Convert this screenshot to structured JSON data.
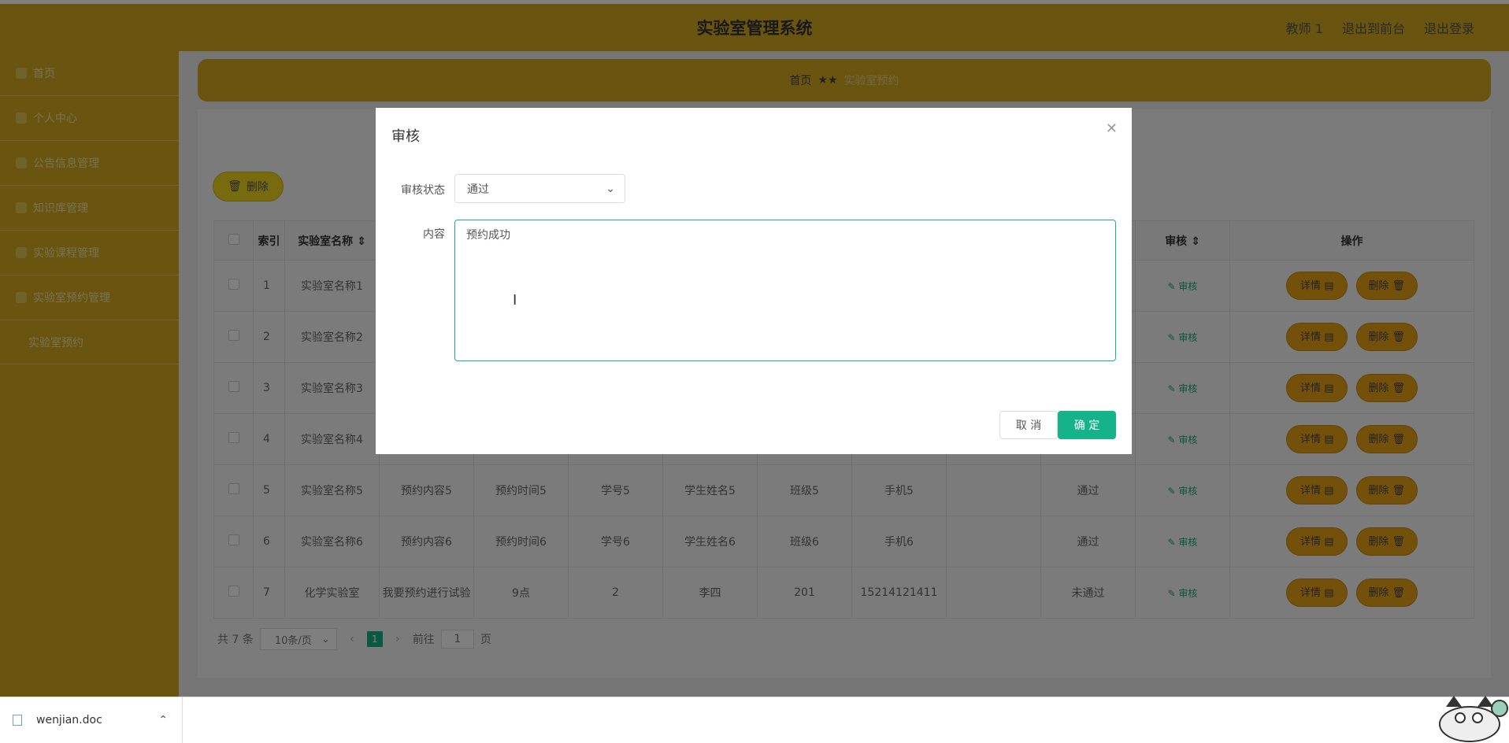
{
  "header": {
    "title": "实验室管理系统",
    "user": "教师 1",
    "back_to_front": "退出到前台",
    "logout": "退出登录"
  },
  "sidebar": {
    "items": [
      {
        "label": "首页"
      },
      {
        "label": "个人中心"
      },
      {
        "label": "公告信息管理"
      },
      {
        "label": "知识库管理"
      },
      {
        "label": "实验课程管理"
      },
      {
        "label": "实验室预约管理"
      }
    ],
    "sub_item": "实验室预约"
  },
  "breadcrumb": {
    "home": "首页",
    "sep": "★★",
    "current": "实验室预约"
  },
  "toolbar": {
    "delete_label": "删除"
  },
  "table": {
    "headers": [
      "索引",
      "实验室名称",
      "",
      "",
      "",
      "",
      "",
      "",
      "",
      "",
      "审核",
      "操作"
    ],
    "rows": [
      {
        "idx": "1",
        "name": "实验室名称1",
        "content": "",
        "time": "",
        "sid": "",
        "sname": "",
        "class": "",
        "phone": "",
        "extra": "",
        "status": "",
        "audit": "审核"
      },
      {
        "idx": "2",
        "name": "实验室名称2",
        "content": "",
        "time": "",
        "sid": "",
        "sname": "",
        "class": "",
        "phone": "",
        "extra": "",
        "status": "",
        "audit": "审核"
      },
      {
        "idx": "3",
        "name": "实验室名称3",
        "content": "",
        "time": "",
        "sid": "",
        "sname": "",
        "class": "",
        "phone": "",
        "extra": "",
        "status": "",
        "audit": "审核"
      },
      {
        "idx": "4",
        "name": "实验室名称4",
        "content": "",
        "time": "",
        "sid": "",
        "sname": "",
        "class": "",
        "phone": "",
        "extra": "",
        "status": "",
        "audit": "审核"
      },
      {
        "idx": "5",
        "name": "实验室名称5",
        "content": "预约内容5",
        "time": "预约时间5",
        "sid": "学号5",
        "sname": "学生姓名5",
        "class": "班级5",
        "phone": "手机5",
        "extra": "",
        "status": "通过",
        "audit": "审核"
      },
      {
        "idx": "6",
        "name": "实验室名称6",
        "content": "预约内容6",
        "time": "预约时间6",
        "sid": "学号6",
        "sname": "学生姓名6",
        "class": "班级6",
        "phone": "手机6",
        "extra": "",
        "status": "通过",
        "audit": "审核"
      },
      {
        "idx": "7",
        "name": "化学实验室",
        "content": "我要预约进行试验",
        "time": "9点",
        "sid": "2",
        "sname": "李四",
        "class": "201",
        "phone": "15214121411",
        "extra": "",
        "status": "未通过",
        "audit": "审核"
      }
    ],
    "detail_label": "详情",
    "delete_label": "删除"
  },
  "pager": {
    "total": "共 7 条",
    "page_size": "10条/页",
    "current_page": "1",
    "goto_prefix": "前往",
    "goto_value": "1",
    "goto_suffix": "页"
  },
  "dialog": {
    "title": "审核",
    "status_label": "审核状态",
    "status_value": "通过",
    "content_label": "内容",
    "content_value": "预约成功",
    "cancel_label": "取 消",
    "ok_label": "确 定"
  },
  "download": {
    "filename": "wenjian.doc"
  }
}
